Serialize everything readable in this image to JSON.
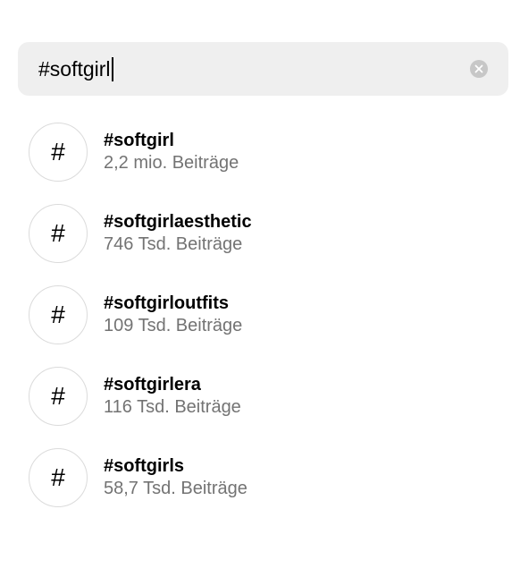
{
  "search": {
    "value": "#softgirl",
    "clear_icon": "x-circle-icon"
  },
  "results": [
    {
      "icon": "#",
      "name": "#softgirl",
      "count": "2,2 mio. Beiträge"
    },
    {
      "icon": "#",
      "name": "#softgirlaesthetic",
      "count": "746 Tsd. Beiträge"
    },
    {
      "icon": "#",
      "name": "#softgirloutfits",
      "count": "109 Tsd. Beiträge"
    },
    {
      "icon": "#",
      "name": "#softgirlera",
      "count": "116 Tsd. Beiträge"
    },
    {
      "icon": "#",
      "name": "#softgirls",
      "count": "58,7 Tsd. Beiträge"
    }
  ],
  "colors": {
    "search_background": "#efefef",
    "secondary_text": "#737373",
    "circle_border": "#dbdbdb"
  }
}
